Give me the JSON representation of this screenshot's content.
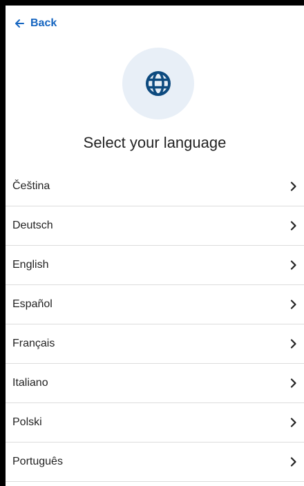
{
  "header": {
    "back_label": "Back"
  },
  "main": {
    "title": "Select your language",
    "icon": "globe-icon"
  },
  "languages": [
    {
      "label": "Čeština"
    },
    {
      "label": "Deutsch"
    },
    {
      "label": "English"
    },
    {
      "label": "Español"
    },
    {
      "label": "Français"
    },
    {
      "label": "Italiano"
    },
    {
      "label": "Polski"
    },
    {
      "label": "Português"
    }
  ],
  "colors": {
    "accent": "#1565c0",
    "globe": "#0d4a7f",
    "globe_bg": "#e8eff7",
    "text": "#222222",
    "divider": "#dcdcdc"
  }
}
